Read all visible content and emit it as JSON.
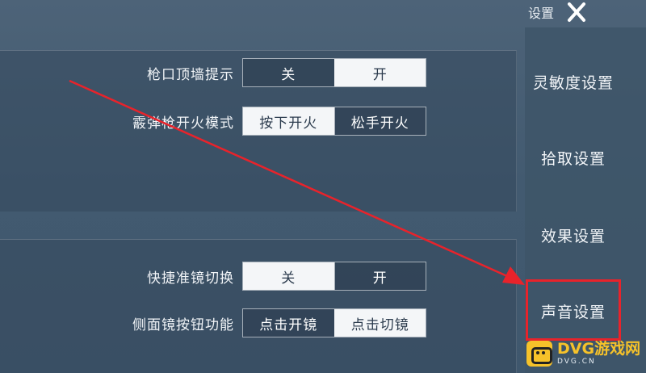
{
  "header": {
    "title": "设置",
    "close_icon": "close-icon"
  },
  "settings": {
    "muzzle_wall_hint": {
      "label": "枪口顶墙提示",
      "options": [
        "关",
        "开"
      ],
      "selected": "开"
    },
    "shotgun_fire_mode": {
      "label": "霰弹枪开火模式",
      "options": [
        "按下开火",
        "松手开火"
      ],
      "selected": "按下开火"
    },
    "quick_scope_switch": {
      "label": "快捷准镜切换",
      "options": [
        "关",
        "开"
      ],
      "selected": "关"
    },
    "side_scope_button": {
      "label": "侧面镜按钮功能",
      "options": [
        "点击开镜",
        "点击切镜"
      ],
      "selected": "点击切镜"
    }
  },
  "sidebar": {
    "items": [
      {
        "label": "灵敏度设置"
      },
      {
        "label": "拾取设置"
      },
      {
        "label": "效果设置"
      },
      {
        "label": "声音设置",
        "highlighted": true
      }
    ]
  },
  "watermark": {
    "main": "DVG游戏网",
    "sub": "DVG.CN"
  },
  "colors": {
    "annotation_red": "#e8232b",
    "watermark_yellow": "#f6c22a",
    "active_segment": "#f4f6f8"
  }
}
